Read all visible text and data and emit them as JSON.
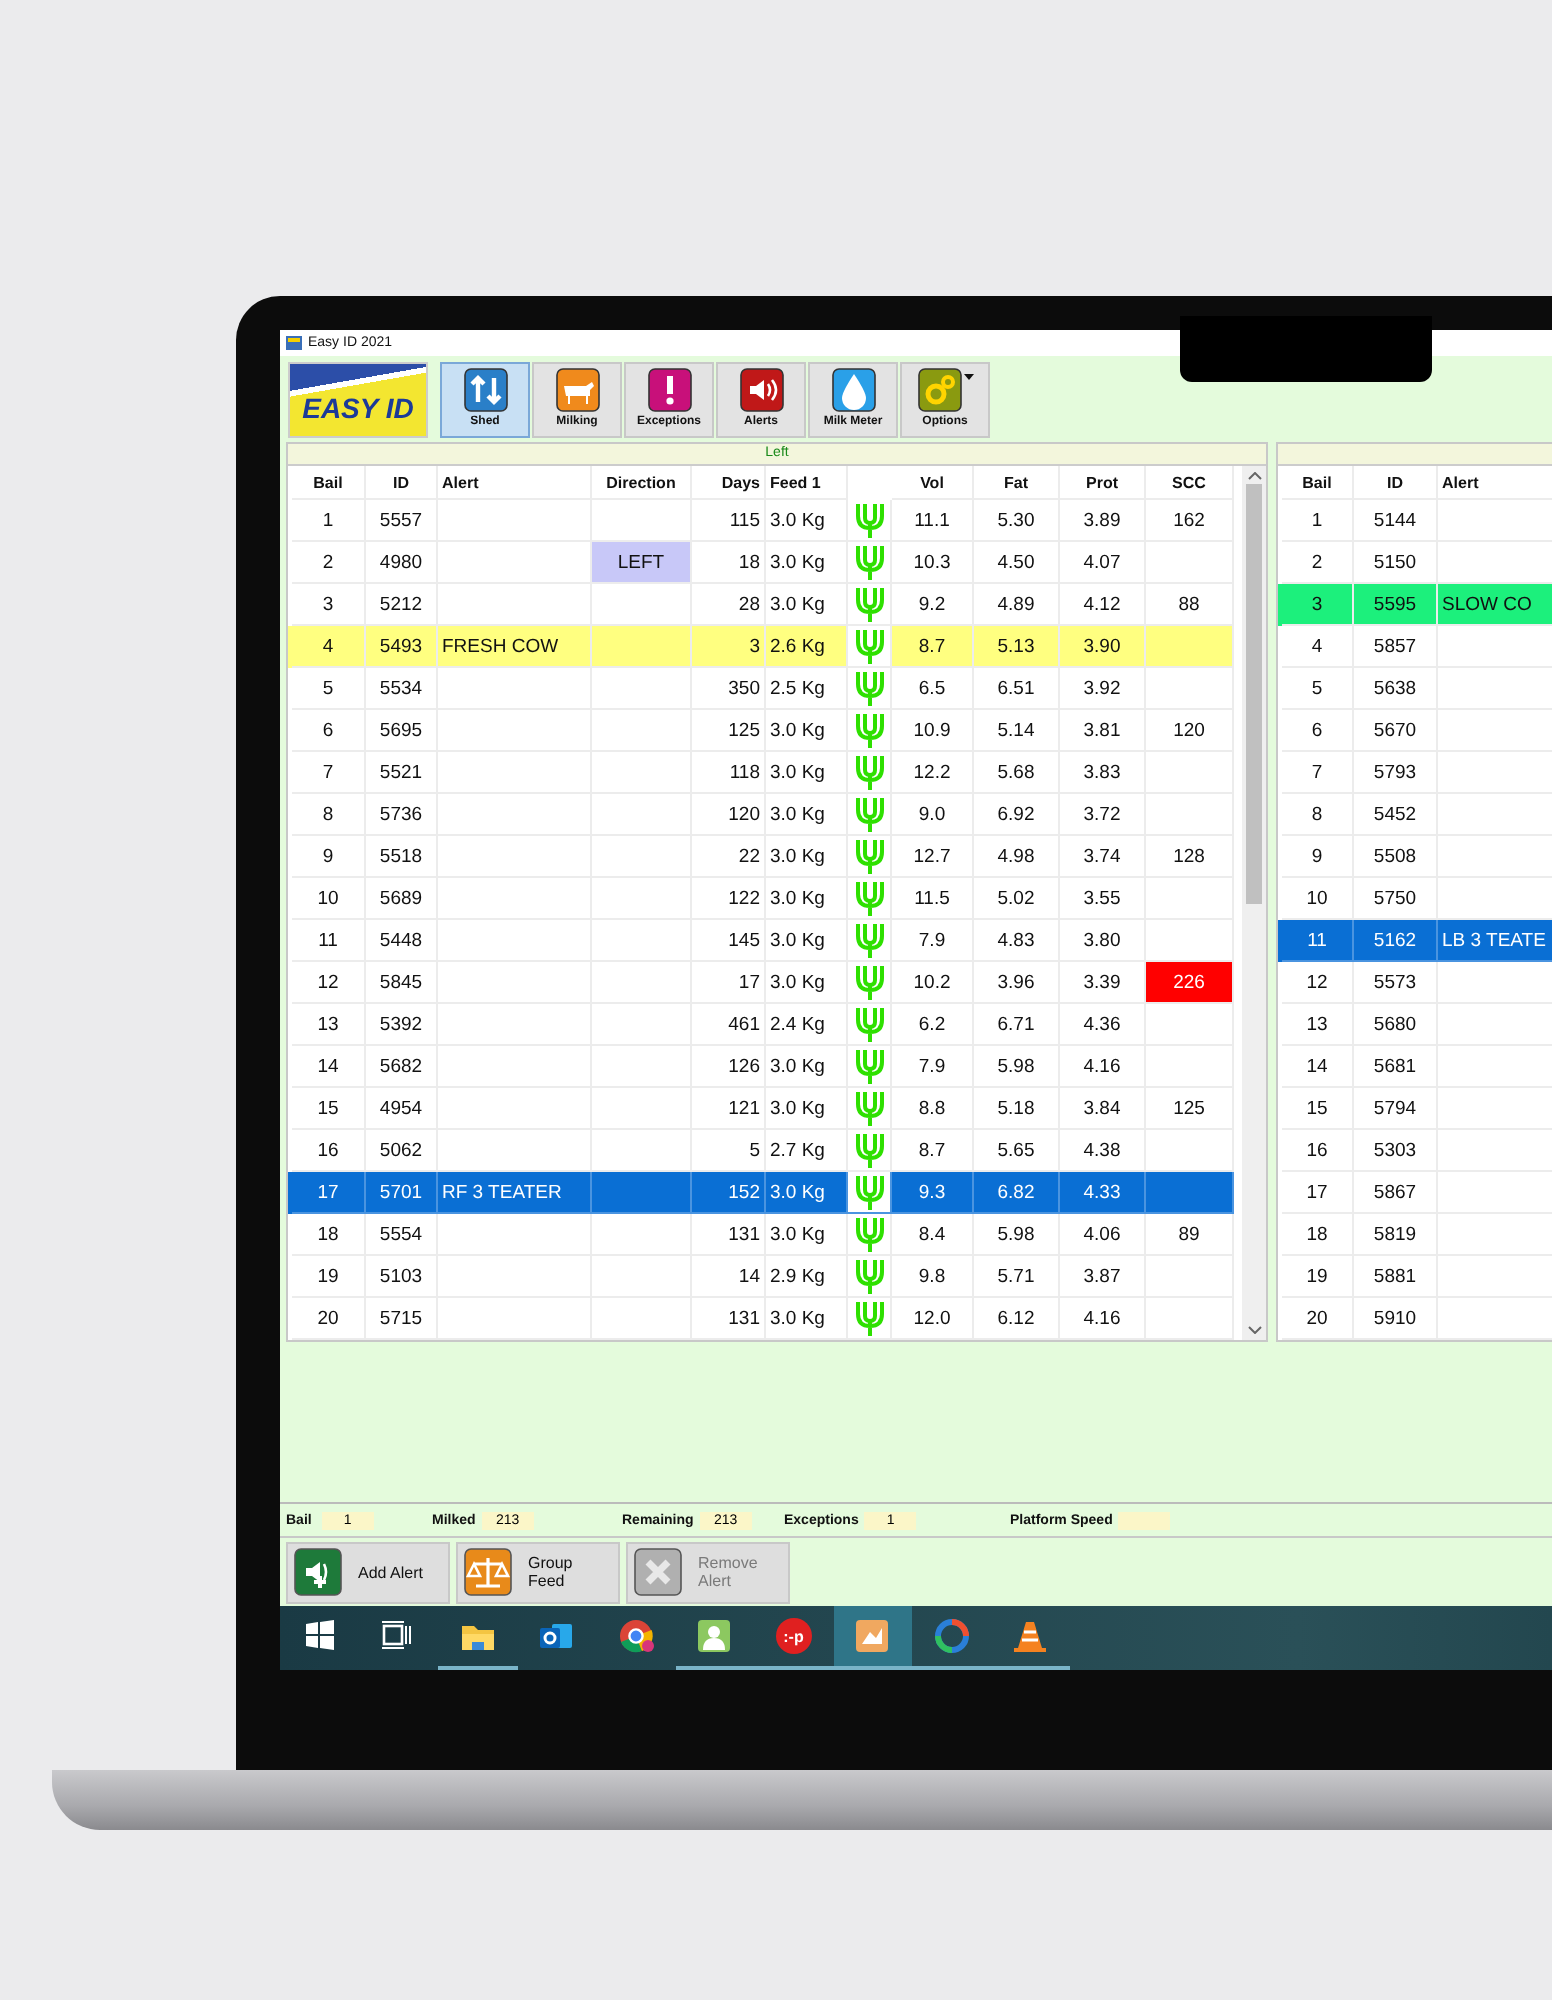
{
  "window": {
    "title": "Easy ID 2021"
  },
  "toolbar": {
    "logo": "EASY ID",
    "buttons": [
      {
        "label": "Shed",
        "kind": "shed",
        "selected": true
      },
      {
        "label": "Milking",
        "kind": "milking",
        "selected": false
      },
      {
        "label": "Exceptions",
        "kind": "exceptions",
        "selected": false
      },
      {
        "label": "Alerts",
        "kind": "alerts",
        "selected": false
      },
      {
        "label": "Milk Meter",
        "kind": "meter",
        "selected": false
      },
      {
        "label": "Options",
        "kind": "options",
        "selected": false
      }
    ]
  },
  "left_panel": {
    "title": "Left",
    "columns": [
      "Bail",
      "ID",
      "Alert",
      "Direction",
      "Days",
      "Feed 1",
      "Vol",
      "Fat",
      "Prot",
      "SCC"
    ],
    "rows": [
      {
        "bail": "1",
        "id": "5557",
        "days": "115",
        "feed": "3.0 Kg",
        "vol": "11.1",
        "fat": "5.30",
        "prot": "3.89",
        "scc": "162",
        "selected": false
      },
      {
        "bail": "2",
        "id": "4980",
        "direction": {
          "text": "LEFT",
          "color": "#c8c8f8"
        },
        "days": "18",
        "feed": "3.0 Kg",
        "vol": "10.3",
        "fat": "4.50",
        "prot": "4.07",
        "selected": false
      },
      {
        "bail": "3",
        "id": "5212",
        "days": "28",
        "feed": "3.0 Kg",
        "vol": "9.2",
        "fat": "4.89",
        "prot": "4.12",
        "scc": "88",
        "selected": false
      },
      {
        "bail": "4",
        "id": "5493",
        "alert": "FRESH COW",
        "color": "#ffff80",
        "days": "3",
        "feed": "2.6 Kg",
        "vol": "8.7",
        "fat": "5.13",
        "prot": "3.90",
        "selected": false
      },
      {
        "bail": "5",
        "id": "5534",
        "days": "350",
        "feed": "2.5 Kg",
        "vol": "6.5",
        "fat": "6.51",
        "prot": "3.92",
        "selected": false
      },
      {
        "bail": "6",
        "id": "5695",
        "days": "125",
        "feed": "3.0 Kg",
        "vol": "10.9",
        "fat": "5.14",
        "prot": "3.81",
        "scc": "120",
        "selected": false
      },
      {
        "bail": "7",
        "id": "5521",
        "days": "118",
        "feed": "3.0 Kg",
        "vol": "12.2",
        "fat": "5.68",
        "prot": "3.83",
        "selected": false
      },
      {
        "bail": "8",
        "id": "5736",
        "days": "120",
        "feed": "3.0 Kg",
        "vol": "9.0",
        "fat": "6.92",
        "prot": "3.72",
        "selected": false
      },
      {
        "bail": "9",
        "id": "5518",
        "days": "22",
        "feed": "3.0 Kg",
        "vol": "12.7",
        "fat": "4.98",
        "prot": "3.74",
        "scc": "128",
        "selected": false
      },
      {
        "bail": "10",
        "id": "5689",
        "days": "122",
        "feed": "3.0 Kg",
        "vol": "11.5",
        "fat": "5.02",
        "prot": "3.55",
        "selected": false
      },
      {
        "bail": "11",
        "id": "5448",
        "days": "145",
        "feed": "3.0 Kg",
        "vol": "7.9",
        "fat": "4.83",
        "prot": "3.80",
        "selected": false
      },
      {
        "bail": "12",
        "id": "5845",
        "days": "17",
        "feed": "3.0 Kg",
        "vol": "10.2",
        "fat": "3.96",
        "prot": "3.39",
        "scc": {
          "text": "226",
          "color": "#ff0000"
        },
        "selected": false
      },
      {
        "bail": "13",
        "id": "5392",
        "days": "461",
        "feed": "2.4 Kg",
        "vol": "6.2",
        "fat": "6.71",
        "prot": "4.36",
        "selected": false
      },
      {
        "bail": "14",
        "id": "5682",
        "days": "126",
        "feed": "3.0 Kg",
        "vol": "7.9",
        "fat": "5.98",
        "prot": "4.16",
        "selected": false
      },
      {
        "bail": "15",
        "id": "4954",
        "days": "121",
        "feed": "3.0 Kg",
        "vol": "8.8",
        "fat": "5.18",
        "prot": "3.84",
        "scc": "125",
        "selected": false
      },
      {
        "bail": "16",
        "id": "5062",
        "days": "5",
        "feed": "2.7 Kg",
        "vol": "8.7",
        "fat": "5.65",
        "prot": "4.38",
        "selected": false
      },
      {
        "bail": "17",
        "id": "5701",
        "alert": "RF 3 TEATER",
        "days": "152",
        "feed": "3.0 Kg",
        "vol": "9.3",
        "fat": "6.82",
        "prot": "4.33",
        "selected": true
      },
      {
        "bail": "18",
        "id": "5554",
        "days": "131",
        "feed": "3.0 Kg",
        "vol": "8.4",
        "fat": "5.98",
        "prot": "4.06",
        "scc": "89",
        "selected": false
      },
      {
        "bail": "19",
        "id": "5103",
        "days": "14",
        "feed": "2.9 Kg",
        "vol": "9.8",
        "fat": "5.71",
        "prot": "3.87",
        "selected": false
      },
      {
        "bail": "20",
        "id": "5715",
        "days": "131",
        "feed": "3.0 Kg",
        "vol": "12.0",
        "fat": "6.12",
        "prot": "4.16",
        "selected": false
      }
    ]
  },
  "right_panel": {
    "columns": [
      "Bail",
      "ID",
      "Alert"
    ],
    "rows": [
      {
        "bail": "1",
        "id": "5144",
        "selected": false
      },
      {
        "bail": "2",
        "id": "5150",
        "selected": false
      },
      {
        "bail": "3",
        "id": "5595",
        "alert": "SLOW CO",
        "color": "#1cf07c",
        "selected": false
      },
      {
        "bail": "4",
        "id": "5857",
        "selected": false
      },
      {
        "bail": "5",
        "id": "5638",
        "selected": false
      },
      {
        "bail": "6",
        "id": "5670",
        "selected": false
      },
      {
        "bail": "7",
        "id": "5793",
        "selected": false
      },
      {
        "bail": "8",
        "id": "5452",
        "selected": false
      },
      {
        "bail": "9",
        "id": "5508",
        "selected": false
      },
      {
        "bail": "10",
        "id": "5750",
        "selected": false
      },
      {
        "bail": "11",
        "id": "5162",
        "alert": "LB 3 TEATE",
        "selected": true
      },
      {
        "bail": "12",
        "id": "5573",
        "selected": false
      },
      {
        "bail": "13",
        "id": "5680",
        "selected": false
      },
      {
        "bail": "14",
        "id": "5681",
        "selected": false
      },
      {
        "bail": "15",
        "id": "5794",
        "selected": false
      },
      {
        "bail": "16",
        "id": "5303",
        "selected": false
      },
      {
        "bail": "17",
        "id": "5867",
        "selected": false
      },
      {
        "bail": "18",
        "id": "5819",
        "selected": false
      },
      {
        "bail": "19",
        "id": "5881",
        "selected": false
      },
      {
        "bail": "20",
        "id": "5910",
        "selected": false
      }
    ]
  },
  "status_bar": [
    {
      "label": "Bail",
      "value": "1"
    },
    {
      "label": "Milked",
      "value": "213"
    },
    {
      "label": "Remaining",
      "value": "213"
    },
    {
      "label": "Exceptions",
      "value": "1"
    },
    {
      "label": "Platform Speed"
    }
  ],
  "actions": [
    {
      "label": "Add Alert",
      "kind": "add-alert",
      "disabled": false
    },
    {
      "label": "Group Feed",
      "kind": "group-feed",
      "disabled": false
    },
    {
      "label": "Remove Alert",
      "kind": "remove-alert",
      "disabled": true
    }
  ],
  "taskbar": [
    {
      "kind": "start",
      "running": false,
      "selected": false
    },
    {
      "kind": "task-view",
      "running": false,
      "selected": false
    },
    {
      "kind": "folder",
      "running": true,
      "selected": false
    },
    {
      "kind": "mail",
      "running": false,
      "selected": false
    },
    {
      "kind": "chrome",
      "running": false,
      "selected": false
    },
    {
      "kind": "contact",
      "running": true,
      "selected": false
    },
    {
      "kind": "emoticon",
      "label": ":-p",
      "running": true,
      "selected": false
    },
    {
      "kind": "app",
      "running": true,
      "selected": true
    },
    {
      "kind": "browser",
      "running": true,
      "selected": false
    },
    {
      "kind": "cone",
      "running": true,
      "selected": false
    }
  ]
}
